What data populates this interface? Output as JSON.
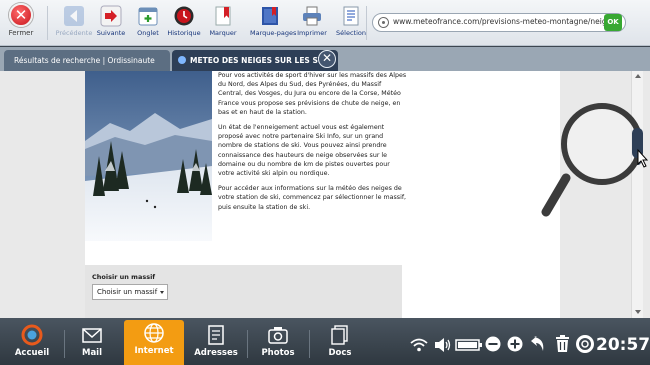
{
  "toolbar": {
    "close_label": "Fermer",
    "buttons": [
      {
        "label": "Précédente",
        "icon": "back-arrow-icon",
        "enabled": false
      },
      {
        "label": "Suivante",
        "icon": "forward-arrow-icon",
        "enabled": true
      },
      {
        "label": "Onglet",
        "icon": "new-tab-icon",
        "enabled": true
      },
      {
        "label": "Historique",
        "icon": "history-icon",
        "enabled": true
      },
      {
        "label": "Marquer",
        "icon": "bookmark-icon",
        "enabled": true
      },
      {
        "label": "Marque-pages",
        "icon": "bookmarks-icon",
        "enabled": true
      },
      {
        "label": "Imprimer",
        "icon": "printer-icon",
        "enabled": true
      },
      {
        "label": "Sélection",
        "icon": "selection-icon",
        "enabled": true
      }
    ],
    "url": "www.meteofrance.com/previsions-meteo-montagne/neige-station",
    "go_label": "OK"
  },
  "tabs": [
    {
      "label": "Résultats de recherche | Ordissinaute",
      "active": false
    },
    {
      "label": "METEO DES NEIGES SUR LES ST",
      "active": true
    }
  ],
  "article": {
    "paragraphs": [
      "Pour vos activités de sport d'hiver sur les massifs des Alpes du Nord, des Alpes du Sud, des Pyrénées, du Massif Central, des Vosges, du Jura ou encore de la Corse, Météo France vous propose ses prévisions de chute de neige, en bas et en haut de la station.",
      "Un état de l'enneigement actuel vous est également proposé avec notre partenaire Ski Info, sur un grand nombre de stations de ski. Vous pouvez ainsi prendre connaissance des hauteurs de neige observées sur le domaine ou du nombre de km de pistes ouvertes pour votre activité ski alpin ou nordique.",
      "Pour accéder aux informations sur la météo des neiges de votre station de ski, commencez par sélectionner le massif, puis ensuite la station de ski."
    ],
    "massif_title": "Choisir un massif",
    "massif_select": "Choisir un massif"
  },
  "taskbar": {
    "apps": [
      {
        "label": "Accueil",
        "icon": "home-icon"
      },
      {
        "label": "Mail",
        "icon": "mail-icon"
      },
      {
        "label": "Internet",
        "icon": "globe-icon",
        "active": true
      },
      {
        "label": "Adresses",
        "icon": "contacts-icon"
      },
      {
        "label": "Photos",
        "icon": "camera-icon"
      },
      {
        "label": "Docs",
        "icon": "documents-icon"
      }
    ],
    "time": "20:57"
  },
  "colors": {
    "accent_active": "#f39c12",
    "tab_active": "#2e3f57",
    "go_button": "#38a832"
  }
}
